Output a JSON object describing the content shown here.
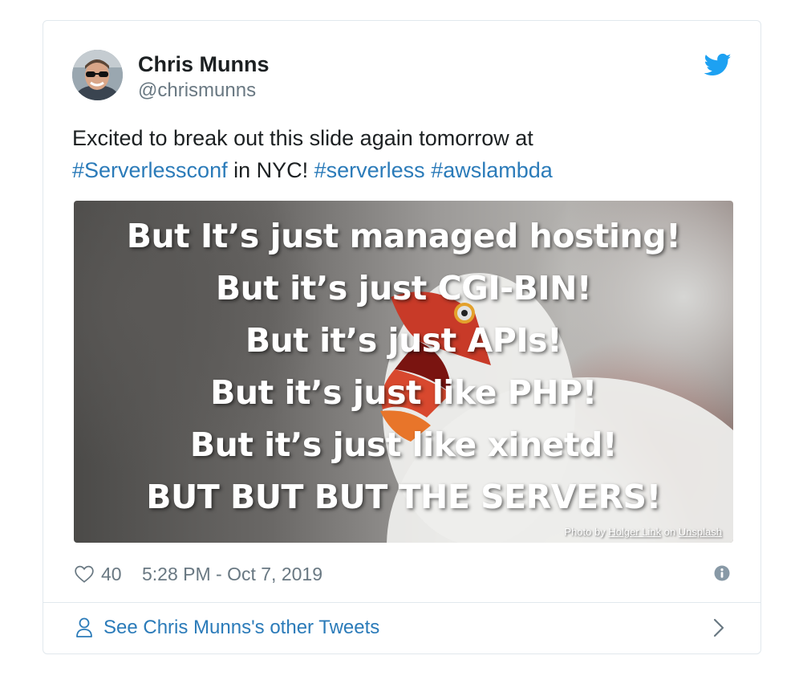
{
  "tweet": {
    "author": {
      "name": "Chris Munns",
      "handle": "@chrismunns"
    },
    "text": {
      "line1": "Excited to break out this slide again tomorrow at",
      "hashtag1": "#Serverlessconf",
      "middle": " in NYC! ",
      "hashtag2": "#serverless",
      "hashtag3": "#awslambda"
    },
    "media": {
      "slide_lines": [
        "But It’s just managed hosting!",
        "But it’s just CGI-BIN!",
        "But it’s just APIs!",
        "But it’s just like PHP!",
        "But it’s just like xinetd!",
        "BUT BUT BUT THE SERVERS!"
      ],
      "credit": {
        "prefix": "Photo by ",
        "photographer": "Holger Link",
        "middle": " on ",
        "site": "Unsplash"
      }
    },
    "footer": {
      "like_count": "40",
      "timestamp": "5:28 PM - Oct 7, 2019"
    },
    "see_more": {
      "label": "See Chris Munns's other Tweets"
    }
  },
  "icons": {
    "brand": "twitter-bird-icon",
    "like": "heart-icon",
    "info": "info-icon",
    "person": "person-icon",
    "chevron": "chevron-right-icon"
  },
  "colors": {
    "brand_blue": "#1da1f2",
    "link_blue": "#2b7bb9",
    "text": "#1c2022",
    "muted": "#697882",
    "border": "#e1e8ed"
  }
}
